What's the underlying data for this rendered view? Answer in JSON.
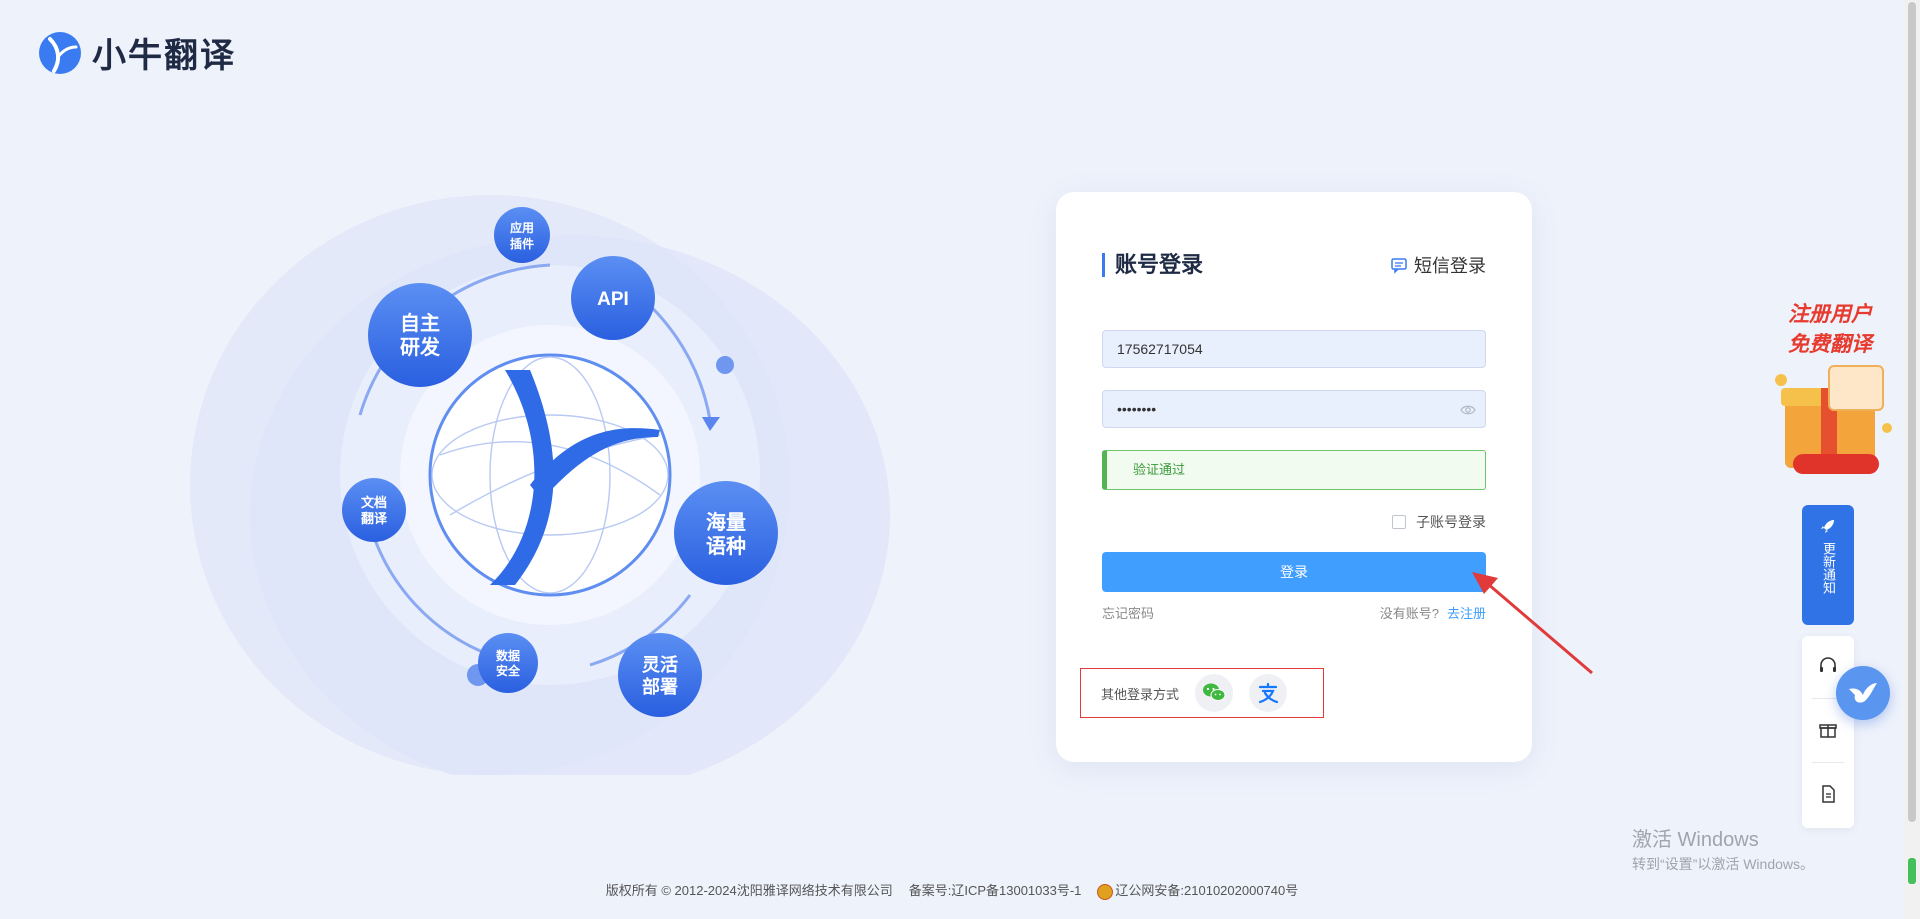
{
  "brand": {
    "name": "小牛翻译"
  },
  "hero": {
    "bubbles": {
      "plugin": "应用|插件",
      "api": "API",
      "self_dev": "自主|研发",
      "doc": "文档|翻译",
      "languages": "海量|语种",
      "data_security": "数据|安全",
      "deploy": "灵活|部署"
    }
  },
  "login": {
    "title": "账号登录",
    "sms_login": "短信登录",
    "username_value": "17562717054",
    "password_value": "••••••••",
    "verify_text": "验证通过",
    "sub_account": "子账号登录",
    "login_button": "登录",
    "forgot_password": "忘记密码",
    "no_account": "没有账号?",
    "register": "去注册",
    "other_methods": "其他登录方式"
  },
  "promo": {
    "line1": "注册用户",
    "line2": "免费翻译"
  },
  "sidebar": {
    "notify": "更新通知"
  },
  "watermark": {
    "line1": "激活 Windows",
    "line2": "转到“设置”以激活 Windows。"
  },
  "footer": {
    "copyright": "版权所有 © 2012-2024沈阳雅译网络技术有限公司",
    "icp": "备案号:辽ICP备13001033号-1",
    "police": "辽公网安备:21010202000740号"
  },
  "colors": {
    "primary": "#409eff",
    "accent_blue": "#2f73e6",
    "verify_green": "#52b452",
    "annotation_red": "#e03a3a"
  }
}
